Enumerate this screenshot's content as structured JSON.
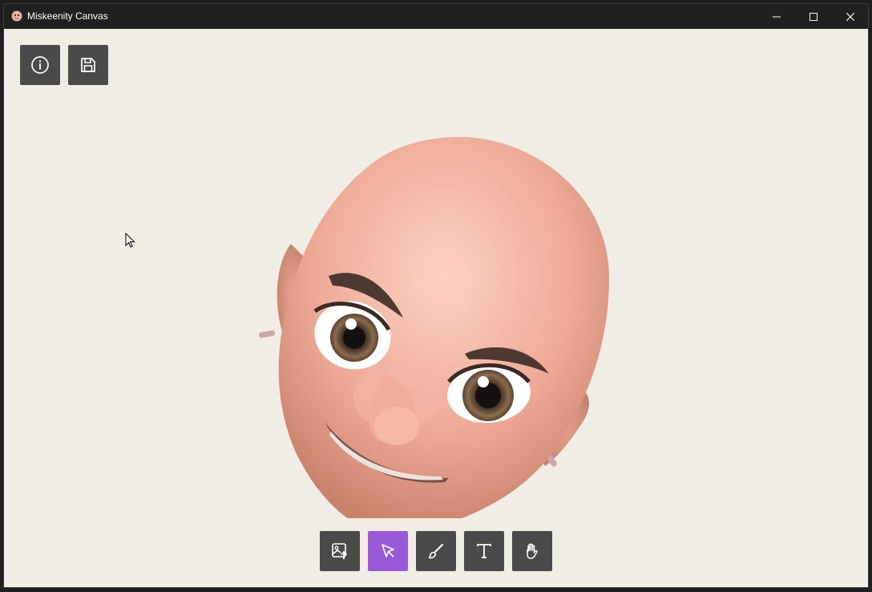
{
  "window": {
    "title": "Miskeenity Canvas",
    "controls": [
      "minimize",
      "maximize",
      "close"
    ]
  },
  "top_toolbar": [
    {
      "name": "info",
      "icon": "info-icon"
    },
    {
      "name": "save",
      "icon": "save-icon"
    }
  ],
  "bottom_toolbar": {
    "active_tool": "select",
    "tools": [
      {
        "name": "image",
        "icon": "image-upload-icon"
      },
      {
        "name": "select",
        "icon": "pointer-icon"
      },
      {
        "name": "brush",
        "icon": "brush-icon"
      },
      {
        "name": "text",
        "icon": "text-icon"
      },
      {
        "name": "pan",
        "icon": "hand-icon"
      }
    ]
  },
  "canvas": {
    "content": "avatar-head-image"
  },
  "colors": {
    "canvas_background": "#f0ede5",
    "titlebar": "#202020",
    "tool_button": "#4a4a4a",
    "tool_active": "#9a59d8"
  }
}
